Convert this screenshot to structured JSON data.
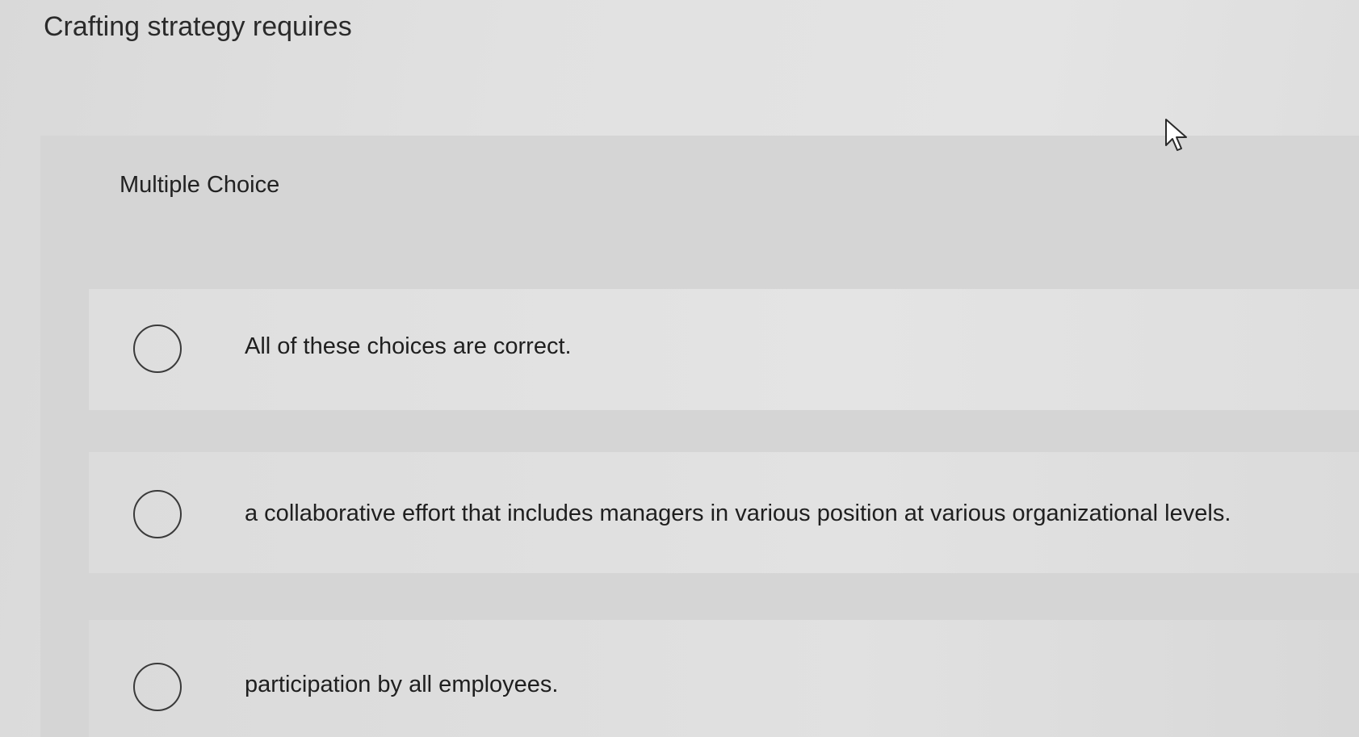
{
  "question": {
    "prompt": "Crafting strategy requires",
    "type_label": "Multiple Choice"
  },
  "choices": [
    {
      "label": "All of these choices are correct.",
      "selected": false
    },
    {
      "label": "a collaborative effort that includes managers in various position at various organizational levels.",
      "selected": false
    },
    {
      "label": "participation by all employees.",
      "selected": false
    }
  ],
  "icons": {
    "radio": "radio-unselected-icon",
    "cursor": "mouse-pointer-icon"
  }
}
